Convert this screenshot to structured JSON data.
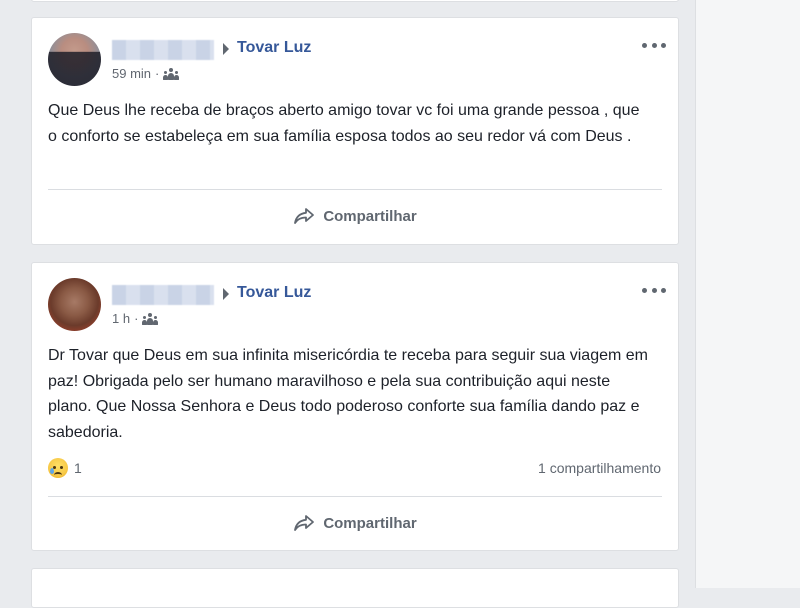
{
  "posts": [
    {
      "page_name": "Tovar Luz",
      "time": "59 min",
      "separator": "·",
      "text": "Que Deus lhe receba de braços aberto amigo tovar vc foi uma grande pessoa , que o conforto se estabeleça em sua família esposa todos ao seu redor vá com Deus .",
      "share_label": "Compartilhar"
    },
    {
      "page_name": "Tovar Luz",
      "time": "1 h",
      "separator": "·",
      "text": "Dr Tovar que Deus em sua infinita misericórdia te receba para seguir sua viagem em paz! Obrigada pelo ser humano maravilhoso e pela sua contribuição aqui neste plano. Que Nossa Senhora e Deus todo poderoso conforte sua família dando paz e sabedoria.",
      "reaction_count": "1",
      "shares_text": "1 compartilhamento",
      "share_label": "Compartilhar"
    }
  ],
  "colors": {
    "link": "#365899",
    "muted": "#616770",
    "text": "#1d2129",
    "background": "#e9ebee"
  },
  "icons": {
    "audience": "friends-icon",
    "more": "more-options-icon",
    "share": "share-arrow-icon",
    "reaction": "sad-reaction-icon"
  }
}
